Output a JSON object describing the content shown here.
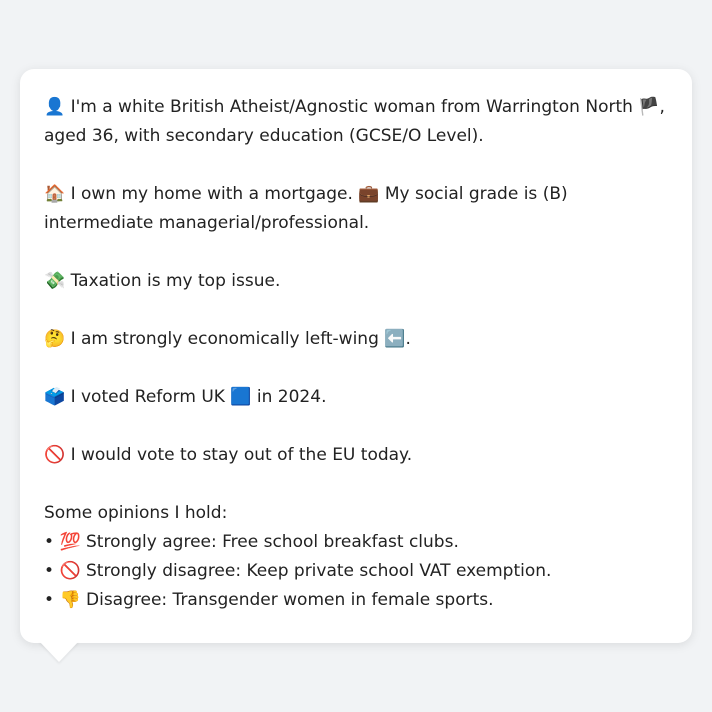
{
  "message": {
    "intro": {
      "emoji": "👤",
      "text_a": " I'm a white British Atheist/Agnostic woman from Warrington North ",
      "flag": "🏴",
      "text_b": ", aged 36, with secondary education (GCSE/O Level)."
    },
    "home": {
      "emoji": "🏠",
      "text_a": " I own my home with a mortgage. ",
      "emoji2": "💼",
      "text_b": " My social grade is (B) intermediate managerial/professional."
    },
    "issue": {
      "emoji": "💸",
      "text": " Taxation is my top issue."
    },
    "economics": {
      "emoji": "🤔",
      "text": " I am strongly economically left-wing ",
      "emoji2": "⬅️",
      "end": "."
    },
    "vote": {
      "emoji": "🗳️",
      "text_a": " I voted Reform UK ",
      "emoji2": "🟦",
      "text_b": " in 2024."
    },
    "eu": {
      "emoji": "🚫",
      "text": " I would vote to stay out of the EU today."
    },
    "opinions": {
      "heading": "Some opinions I hold:",
      "items": [
        {
          "bullet": "• ",
          "emoji": "💯",
          "text": " Strongly agree: Free school breakfast clubs."
        },
        {
          "bullet": "• ",
          "emoji": "🚫",
          "text": " Strongly disagree: Keep private school VAT exemption."
        },
        {
          "bullet": "• ",
          "emoji": "👎",
          "text": " Disagree: Transgender women in female sports."
        }
      ]
    }
  }
}
